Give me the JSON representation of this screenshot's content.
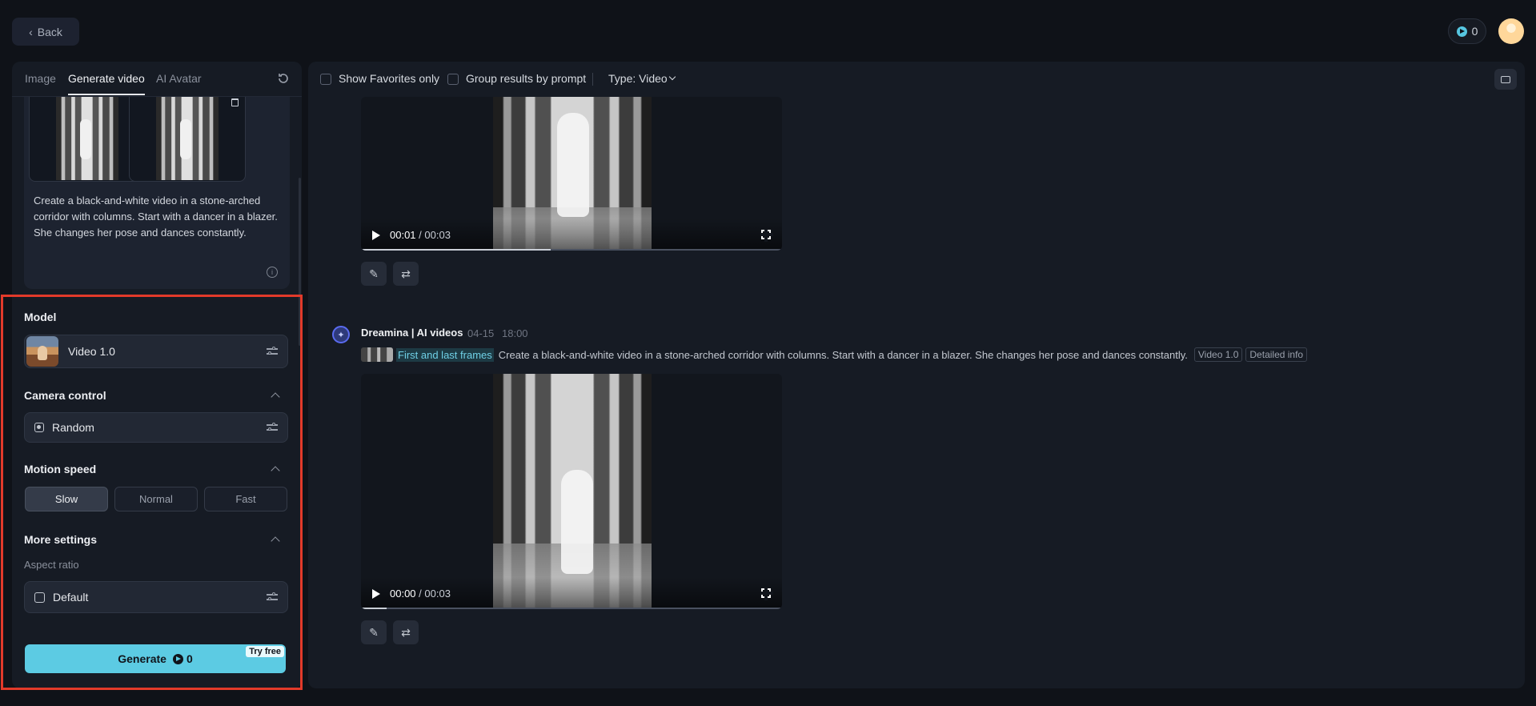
{
  "topbar": {
    "back_label": "Back",
    "credits": "0"
  },
  "tabs": [
    {
      "label": "Image"
    },
    {
      "label": "Generate video"
    },
    {
      "label": "AI Avatar"
    }
  ],
  "prompt": {
    "text": "Create a black-and-white video in a stone-arched corridor with columns. Start with a dancer in a blazer. She changes her pose and dances constantly."
  },
  "settings": {
    "model_title": "Model",
    "model_value": "Video 1.0",
    "camera_title": "Camera control",
    "camera_value": "Random",
    "motion_title": "Motion speed",
    "speeds": [
      "Slow",
      "Normal",
      "Fast"
    ],
    "selected_speed": "Slow",
    "more_title": "More settings",
    "aspect_label": "Aspect ratio",
    "aspect_value": "Default",
    "generate_label": "Generate",
    "generate_credits": "0",
    "try_free": "Try free"
  },
  "filters": {
    "favorites": "Show Favorites only",
    "group": "Group results by prompt",
    "type": "Type: Video"
  },
  "results": [
    {
      "time_current": "00:01",
      "time_total": "/ 00:03",
      "progress": 0.45
    },
    {
      "author": "Dreamina | AI videos",
      "date": "04-15",
      "time": "18:00",
      "frames_tag": "First and last frames",
      "prompt": "Create a black-and-white video in a stone-arched corridor with columns. Start with a dancer in a blazer. She changes her pose and dances constantly.",
      "model_tag": "Video 1.0",
      "info_tag": "Detailed info",
      "time_current": "00:00",
      "time_total": "/ 00:03",
      "progress": 0.06
    }
  ]
}
